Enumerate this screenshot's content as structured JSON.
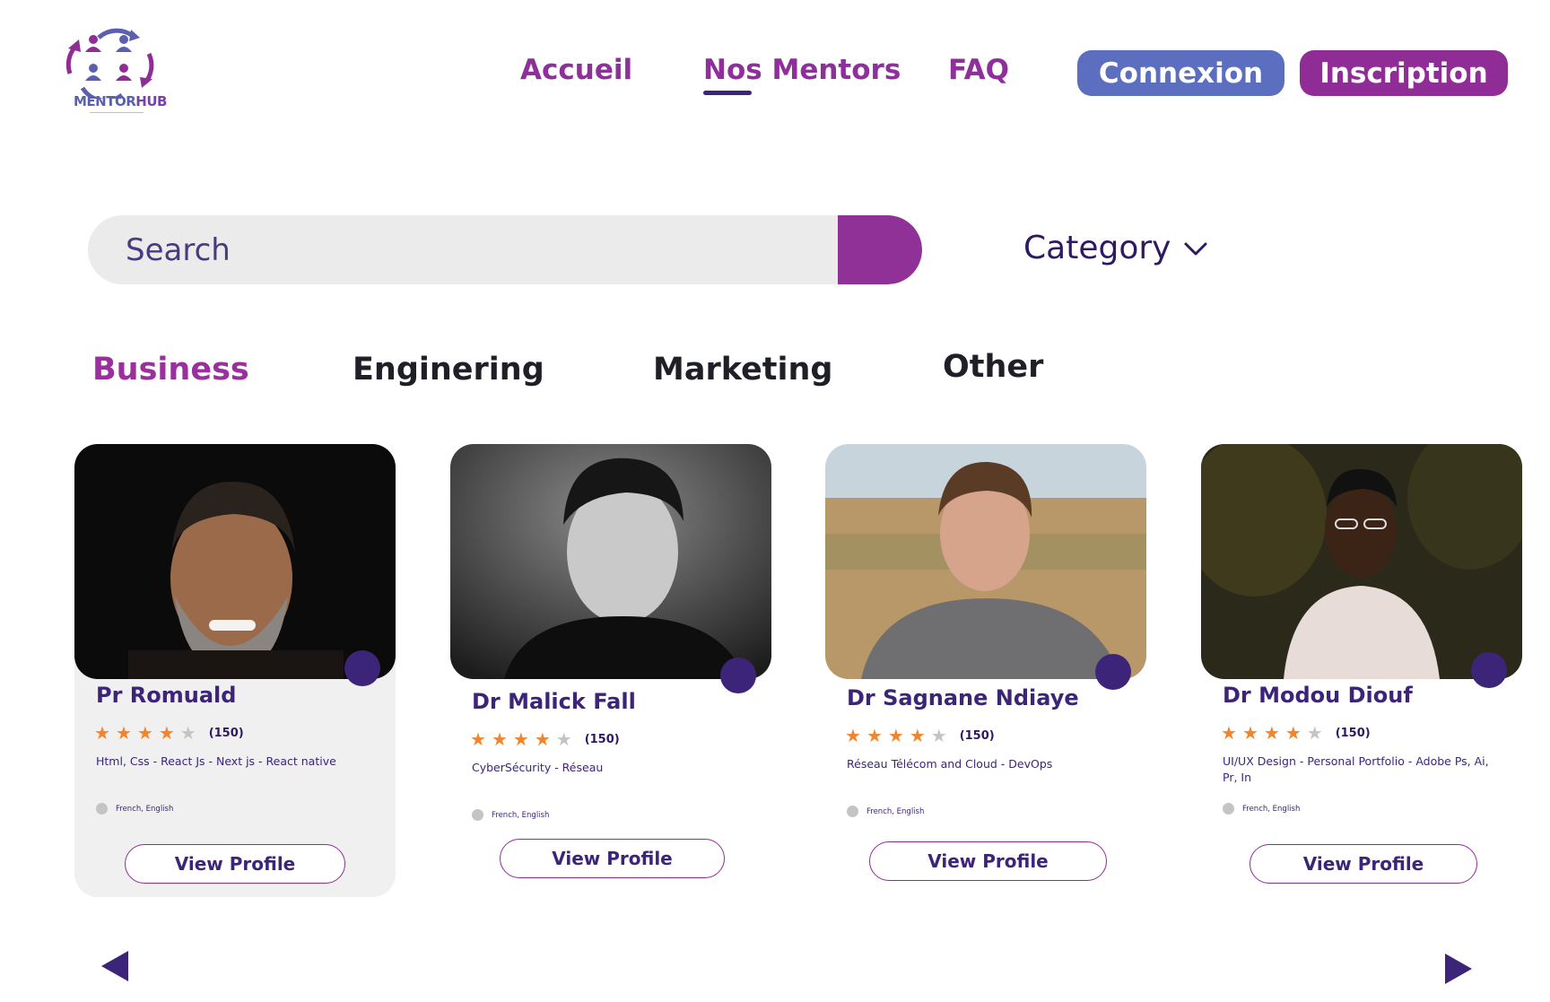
{
  "brand": {
    "logo_text_1": "MENTOR",
    "logo_text_2": "HUB",
    "colors": {
      "purple": "#8f2c96",
      "blue": "#5b6ebf",
      "navy": "#3c2578",
      "star": "#f0852b"
    }
  },
  "nav": {
    "items": [
      {
        "label": "Accueil"
      },
      {
        "label": "Nos Mentors",
        "active": true
      },
      {
        "label": "FAQ"
      }
    ],
    "connexion_label": "Connexion",
    "inscription_label": "Inscription"
  },
  "search": {
    "placeholder": "Search",
    "value": ""
  },
  "category": {
    "label": "Category",
    "icon": "chevron-down-icon"
  },
  "tabs": [
    {
      "label": "Business",
      "active": true
    },
    {
      "label": "Enginering"
    },
    {
      "label": "Marketing"
    },
    {
      "label": "Other"
    }
  ],
  "mentors": [
    {
      "name": "Pr Romuald",
      "rating": 4,
      "max_rating": 5,
      "reviews": "(150)",
      "skills": "Html, Css -  React Js -  Next js -  React native",
      "languages": "French, English",
      "button": "View Profile"
    },
    {
      "name": "Dr Malick Fall",
      "rating": 4,
      "max_rating": 5,
      "reviews": "(150)",
      "skills": "CyberSécurity - Réseau",
      "languages": "French, English",
      "button": "View Profile"
    },
    {
      "name": "Dr Sagnane Ndiaye",
      "rating": 4,
      "max_rating": 5,
      "reviews": "(150)",
      "skills": "Réseau Télécom and Cloud - DevOps",
      "languages": "French, English",
      "button": "View Profile"
    },
    {
      "name": "Dr Modou Diouf",
      "rating": 4,
      "max_rating": 5,
      "reviews": "(150)",
      "skills": "UI/UX Design - Personal Portfolio - Adobe Ps, Ai, Pr, In",
      "languages": "French, English",
      "button": "View Profile"
    }
  ],
  "pager": {
    "prev_icon": "triangle-left-icon",
    "next_icon": "triangle-right-icon"
  }
}
